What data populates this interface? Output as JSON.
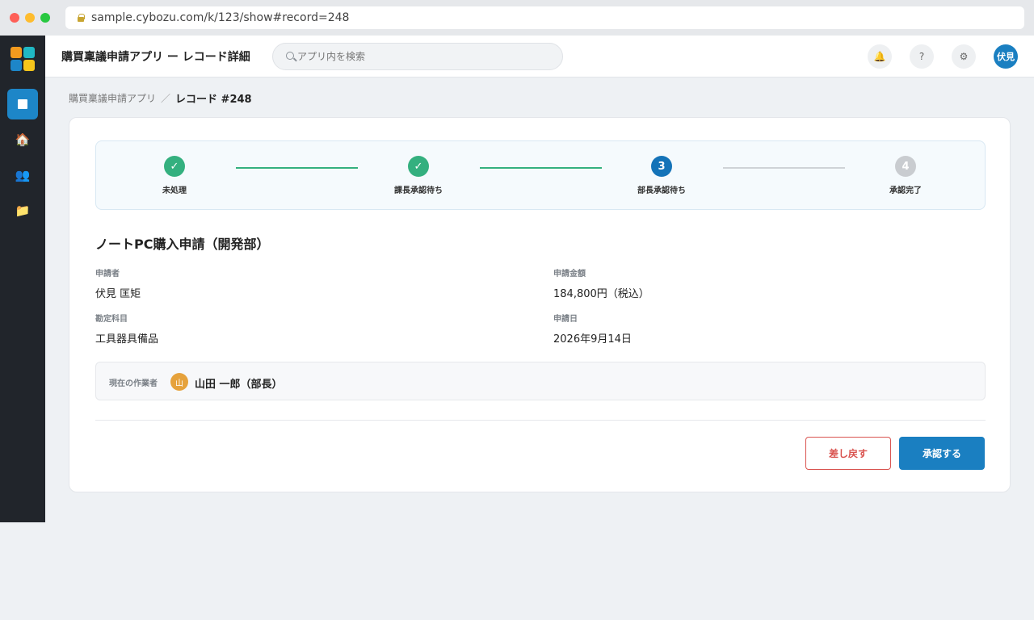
{
  "browser": {
    "url": "sample.cybozu.com/k/123/show#record=248"
  },
  "sidebar": {
    "logo_colors": [
      "#f39a1e",
      "#1fb8c4",
      "#1d86c8",
      "#f5c51b"
    ],
    "items": [
      {
        "name": "app-icon",
        "active": true
      },
      {
        "name": "home-icon",
        "glyph": "🏠"
      },
      {
        "name": "people-icon",
        "glyph": "👥"
      },
      {
        "name": "folder-icon",
        "glyph": "📁"
      }
    ]
  },
  "header": {
    "title": "購買稟議申請アプリ ー レコード詳細",
    "search_placeholder": "アプリ内を検索",
    "notification_glyph": "🔔",
    "help_glyph": "?",
    "settings_glyph": "⚙",
    "user_initials": "伏見"
  },
  "breadcrumb": {
    "parent": "購買稟議申請アプリ",
    "separator": "／",
    "current": "レコード #248"
  },
  "workflow": {
    "steps": [
      {
        "label": "未処理",
        "status": "done",
        "mark": "✓"
      },
      {
        "label": "課長承認待ち",
        "status": "done",
        "mark": "✓"
      },
      {
        "label": "部長承認待ち",
        "status": "current",
        "mark": "3"
      },
      {
        "label": "承認完了",
        "status": "pending",
        "mark": "4"
      }
    ]
  },
  "record": {
    "title": "ノートPC購入申請（開発部）",
    "fields": {
      "applicant_label": "申請者",
      "applicant_value": "伏見 匡矩",
      "amount_label": "申請金額",
      "amount_value": "184,800円（税込）",
      "account_label": "勘定科目",
      "account_value": "工具器具備品",
      "date_label": "申請日",
      "date_value": "2026年9月14日"
    },
    "worker": {
      "label": "現在の作業者",
      "avatar_char": "山",
      "name": "山田 一郎（部長）"
    }
  },
  "actions": {
    "back_label": "差し戻す",
    "approve_label": "承認する"
  },
  "colors": {
    "accent": "#1a7fc1",
    "done": "#34b07f",
    "danger": "#d9534f",
    "sidebar_bg": "#21252b"
  }
}
